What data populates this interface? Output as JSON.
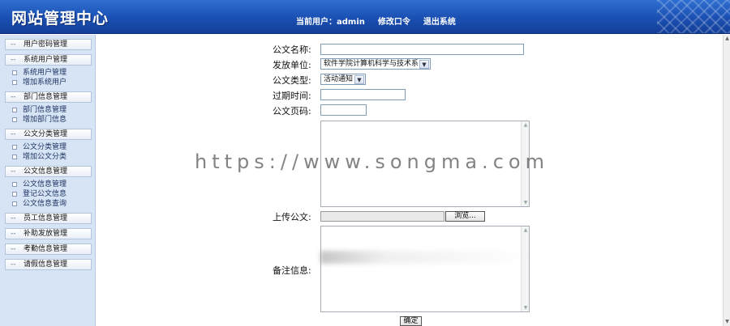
{
  "header": {
    "logo": "网站管理中心",
    "current_user_label": "当前用户：",
    "current_user": "admin",
    "change_password": "修改口令",
    "logout": "退出系统"
  },
  "sidebar": {
    "groups": [
      {
        "label": "用户密码管理",
        "items": []
      },
      {
        "label": "系统用户管理",
        "items": [
          "系统用户管理",
          "增加系统用户"
        ]
      },
      {
        "label": "部门信息管理",
        "items": [
          "部门信息管理",
          "增加部门信息"
        ]
      },
      {
        "label": "公文分类管理",
        "items": [
          "公文分类管理",
          "增加公文分类"
        ]
      },
      {
        "label": "公文信息管理",
        "items": [
          "公文信息管理",
          "登记公文信息",
          "公文信息查询"
        ]
      },
      {
        "label": "员工信息管理",
        "items": []
      },
      {
        "label": "补助发放管理",
        "items": []
      },
      {
        "label": "考勤信息管理",
        "items": []
      },
      {
        "label": "请假信息管理",
        "items": []
      }
    ]
  },
  "form": {
    "title_label": "公文名称:",
    "title_value": "",
    "unit_label": "发放单位:",
    "unit_value": "软件学院计算机科学与技术系",
    "type_label": "公文类型:",
    "type_value": "活动通知",
    "expire_label": "过期时间:",
    "expire_value": "",
    "pages_label": "公文页码:",
    "pages_value": "",
    "upload_label": "上传公文:",
    "browse_label": "浏览...",
    "remark_label": "备注信息:",
    "submit_label": "确定"
  },
  "watermark": "https://www.songma.com"
}
